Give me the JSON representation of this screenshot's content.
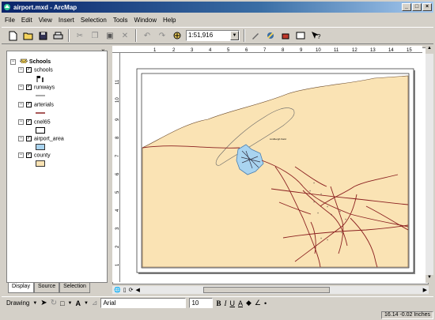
{
  "window": {
    "title": "airport.mxd - ArcMap"
  },
  "menu": [
    "File",
    "Edit",
    "View",
    "Insert",
    "Selection",
    "Tools",
    "Window",
    "Help"
  ],
  "toolbar": {
    "scale": "1:51,916"
  },
  "toc": {
    "root": "Schools",
    "layers": [
      {
        "name": "schools"
      },
      {
        "name": "runways"
      },
      {
        "name": "arterials"
      },
      {
        "name": "cnel65"
      },
      {
        "name": "airport_area"
      },
      {
        "name": "county"
      }
    ]
  },
  "tabs": [
    "Display",
    "Source",
    "Selection"
  ],
  "ruler": {
    "h": [
      "1",
      "2",
      "3",
      "4",
      "5",
      "6",
      "7",
      "8",
      "9",
      "10",
      "11",
      "12",
      "13",
      "14",
      "15"
    ],
    "v": [
      "11",
      "10",
      "9",
      "8",
      "7",
      "6",
      "5",
      "4",
      "3",
      "2",
      "1"
    ]
  },
  "map": {
    "label": "Lindbergh Field"
  },
  "drawing": {
    "menu": "Drawing",
    "font": "Arial",
    "size": "10"
  },
  "status": {
    "coords": "16.14  -0.02 Inches"
  },
  "colors": {
    "county": "#fae3b4",
    "airport": "#a9d4f0",
    "roads": "#8b2020"
  }
}
